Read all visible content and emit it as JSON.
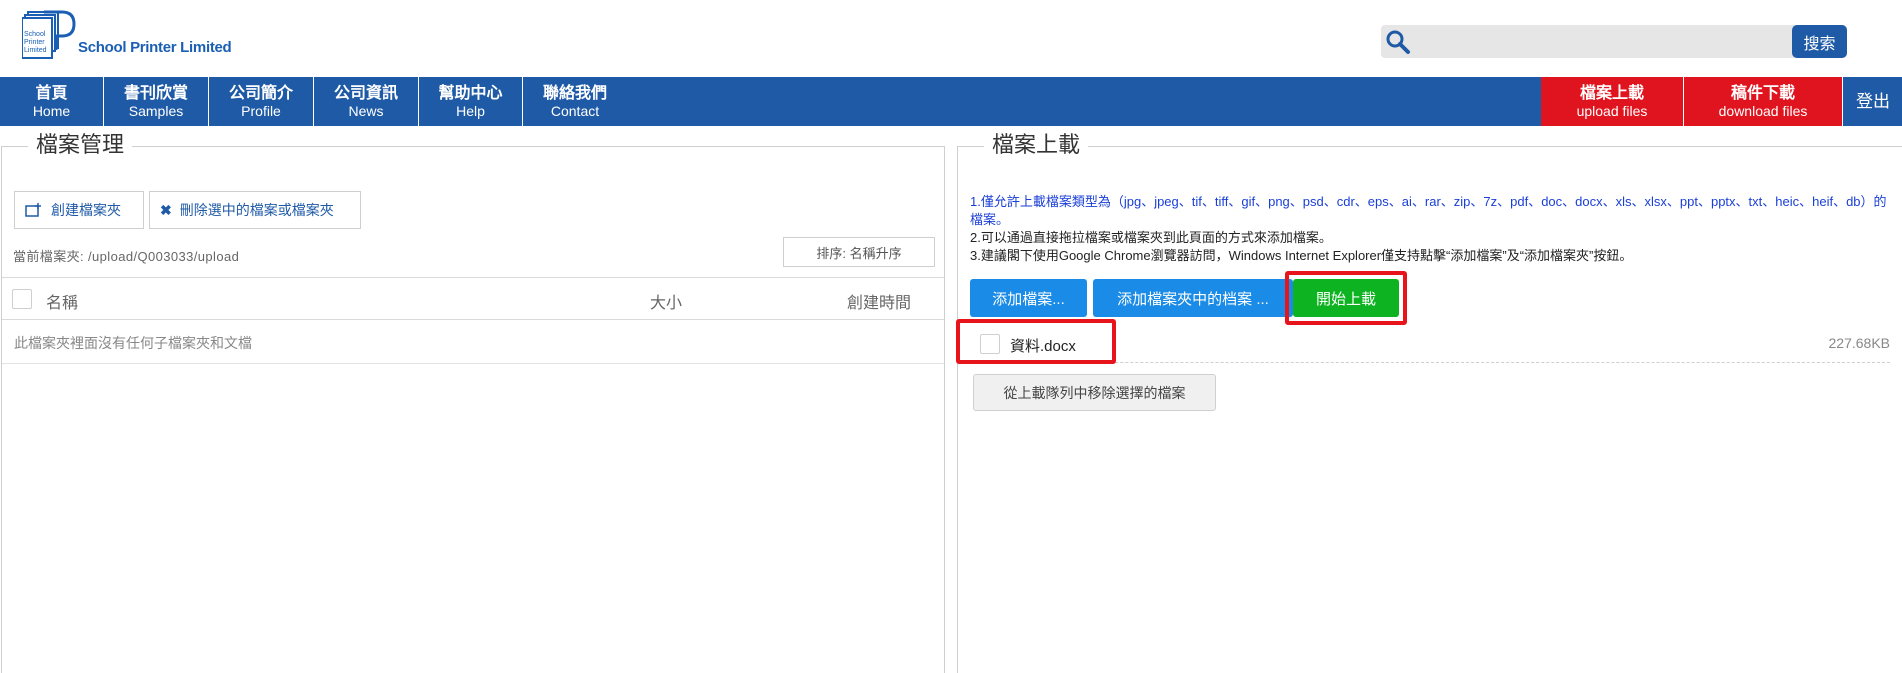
{
  "header": {
    "logo_text": "School Printer Limited",
    "logo_mark_line1": "School",
    "logo_mark_line2": "Printer",
    "logo_mark_line3": "Limited",
    "search_placeholder": "",
    "search_button": "搜索"
  },
  "nav": {
    "items": [
      {
        "zh": "首頁",
        "en": "Home"
      },
      {
        "zh": "書刊欣賞",
        "en": "Samples"
      },
      {
        "zh": "公司簡介",
        "en": "Profile"
      },
      {
        "zh": "公司資訊",
        "en": "News"
      },
      {
        "zh": "幫助中心",
        "en": "Help"
      },
      {
        "zh": "聯絡我們",
        "en": "Contact"
      }
    ],
    "upload": {
      "zh": "檔案上載",
      "en": "upload files"
    },
    "download": {
      "zh": "稿件下載",
      "en": "download files"
    },
    "logout": "登出"
  },
  "file_manager": {
    "title": "檔案管理",
    "create_folder": "創建檔案夾",
    "delete_selected": "刪除選中的檔案或檔案夾",
    "current_folder": "當前檔案夾: /upload/Q003033/upload",
    "sort": "排序: 名稱升序",
    "columns": {
      "name": "名稱",
      "size": "大小",
      "created": "創建時間"
    },
    "empty_message": "此檔案夾裡面沒有任何子檔案夾和文檔"
  },
  "uploader": {
    "title": "檔案上載",
    "instruction1": "1.僅允許上載檔案類型為（jpg、jpeg、tif、tiff、gif、png、psd、cdr、eps、ai、rar、zip、7z、pdf、doc、docx、xls、xlsx、ppt、pptx、txt、heic、heif、db）的檔案。",
    "instruction2": "2.可以通過直接拖拉檔案或檔案夾到此頁面的方式來添加檔案。",
    "instruction3": "3.建議閣下使用Google Chrome瀏覽器訪問，Windows Internet Explorer僅支持點擊“添加檔案”及“添加檔案夾”按鈕。",
    "add_files": "添加檔案...",
    "add_folder_files": "添加檔案夾中的档案 ...",
    "start_upload": "開始上載",
    "queue": [
      {
        "name": "資料.docx",
        "size": "227.68KB"
      }
    ],
    "remove_selected": "從上載隊列中移除選擇的檔案"
  },
  "colors": {
    "nav_blue": "#1f5aa6",
    "nav_red": "#e0141e",
    "button_blue": "#1a8be6",
    "button_green": "#0eb321",
    "highlight_red": "#e8141c"
  }
}
